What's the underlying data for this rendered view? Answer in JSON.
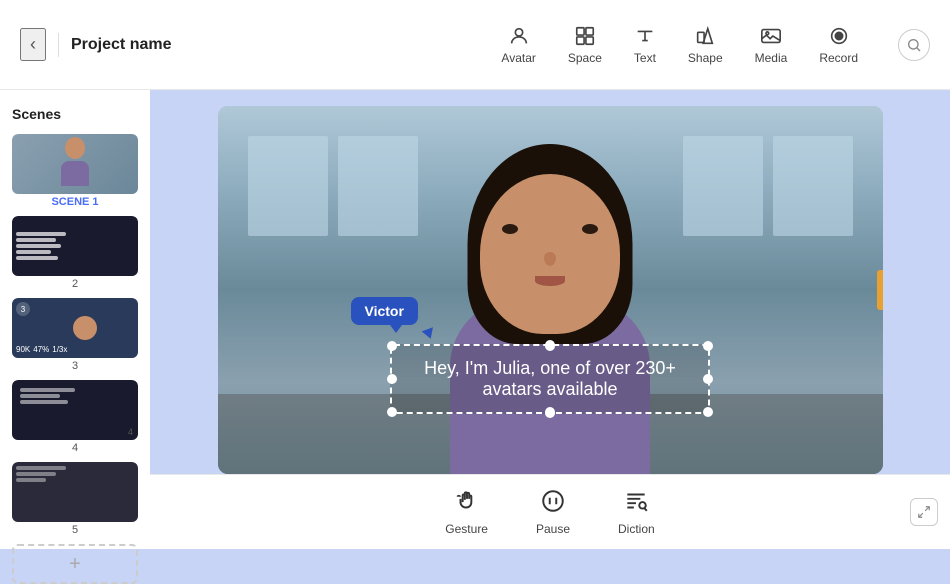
{
  "topbar": {
    "back_icon": "‹",
    "project_name": "Project name",
    "toolbar": {
      "items": [
        {
          "id": "avatar",
          "icon": "avatar",
          "label": "Avatar"
        },
        {
          "id": "space",
          "icon": "space",
          "label": "Space"
        },
        {
          "id": "text",
          "icon": "text",
          "label": "Text"
        },
        {
          "id": "shape",
          "icon": "shape",
          "label": "Shape"
        },
        {
          "id": "media",
          "icon": "media",
          "label": "Media"
        },
        {
          "id": "record",
          "icon": "record",
          "label": "Record"
        }
      ]
    }
  },
  "sidebar": {
    "title": "Scenes",
    "scenes": [
      {
        "id": 1,
        "label": "SCENE 1",
        "active": true
      },
      {
        "id": 2,
        "label": "2",
        "active": false
      },
      {
        "id": 3,
        "label": "3",
        "active": false
      },
      {
        "id": 4,
        "label": "4",
        "active": false
      },
      {
        "id": 5,
        "label": "5",
        "active": false
      }
    ],
    "add_label": "+"
  },
  "canvas": {
    "avatar_tooltip": "Victor",
    "subtitle_text": "Hey, I'm Julia, one of over 230+ avatars available"
  },
  "bottom_toolbar": {
    "items": [
      {
        "id": "gesture",
        "icon": "gesture",
        "label": "Gesture"
      },
      {
        "id": "pause",
        "icon": "pause",
        "label": "Pause"
      },
      {
        "id": "diction",
        "icon": "diction",
        "label": "Diction"
      }
    ]
  }
}
